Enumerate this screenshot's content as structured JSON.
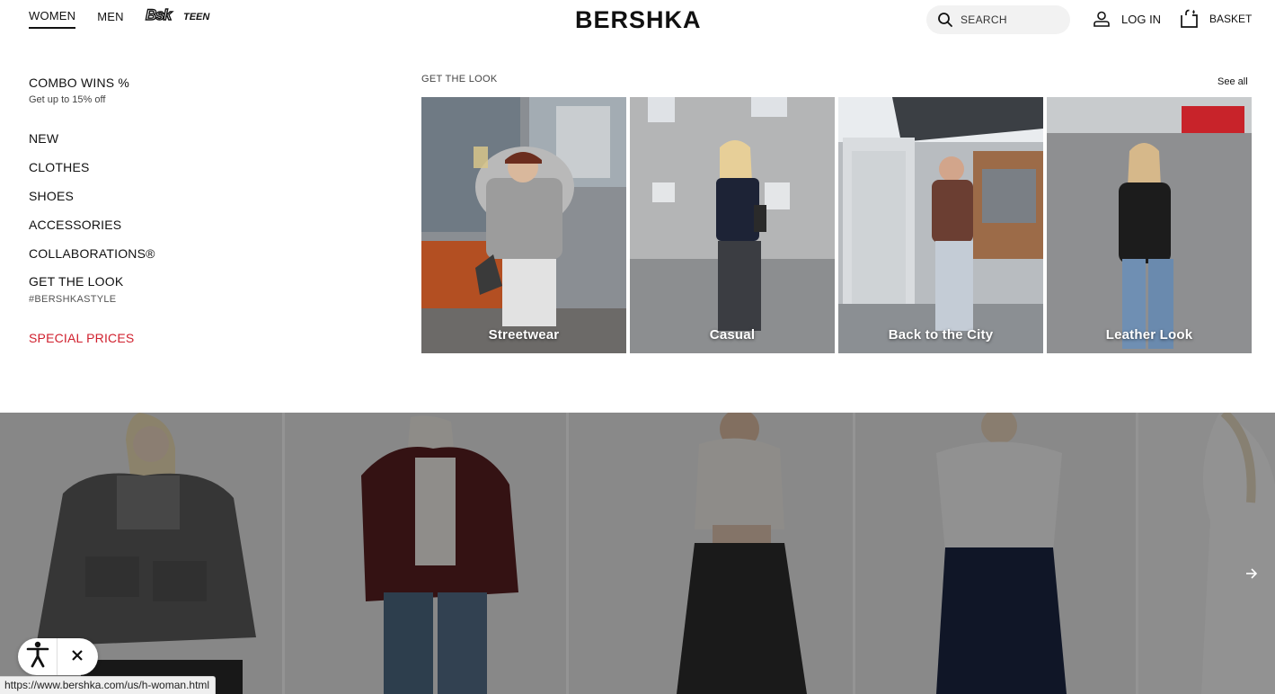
{
  "header": {
    "tabs": [
      {
        "label": "WOMEN",
        "active": true
      },
      {
        "label": "MEN",
        "active": false
      }
    ],
    "teen_logo": "Bsk TEEN",
    "brand": "BERSHKA",
    "search": {
      "placeholder": "SEARCH",
      "icon": "search-icon"
    },
    "login": {
      "label": "LOG IN",
      "icon": "user-icon"
    },
    "basket": {
      "label": "BASKET",
      "icon": "basket-icon"
    }
  },
  "menu": {
    "promo": {
      "title": "COMBO WINS %",
      "subtitle": "Get up to 15% off"
    },
    "items": [
      {
        "label": "NEW"
      },
      {
        "label": "CLOTHES"
      },
      {
        "label": "SHOES"
      },
      {
        "label": "ACCESSORIES"
      },
      {
        "label": "COLLABORATIONS®"
      },
      {
        "label": "GET THE LOOK",
        "sub": "#BERSHKASTYLE"
      }
    ],
    "special": {
      "label": "SPECIAL PRICES",
      "color": "#d0202e"
    }
  },
  "get_the_look": {
    "heading": "GET THE LOOK",
    "see_all": "See all",
    "cards": [
      {
        "label": "Streetwear"
      },
      {
        "label": "Casual"
      },
      {
        "label": "Back to the City"
      },
      {
        "label": "Leather Look"
      }
    ]
  },
  "carousel": {
    "next_icon": "arrow-right-icon"
  },
  "accessibility": {
    "icon": "accessibility-person-icon",
    "close_icon": "close-icon"
  },
  "status_url": "https://www.bershka.com/us/h-woman.html"
}
